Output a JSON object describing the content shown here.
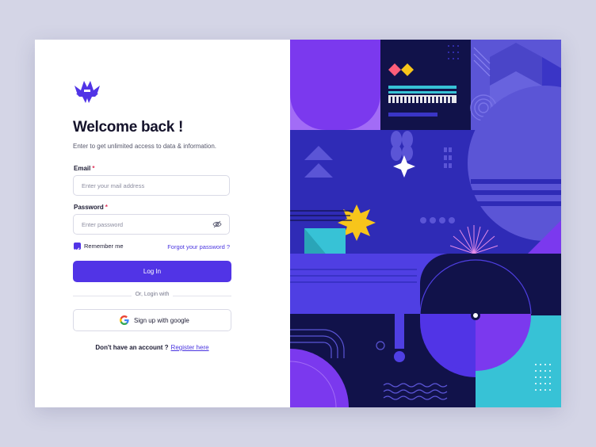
{
  "brand": {
    "logo_icon": "crown-star-logo-icon",
    "accent_color": "#5134e6"
  },
  "heading": {
    "title": "Welcome back !",
    "subtitle": "Enter to get unlimited access to data & information."
  },
  "form": {
    "email": {
      "label": "Email",
      "required_mark": "*",
      "placeholder": "Enter your mail address",
      "value": ""
    },
    "password": {
      "label": "Password",
      "required_mark": "*",
      "placeholder": "Enter password",
      "value": "",
      "toggle_icon": "eye-off-icon"
    },
    "remember_label": "Remember me",
    "remember_checked": true,
    "forgot_label": "Forgot your password ?",
    "submit_label": "Log In",
    "divider_text": "Or, Login with",
    "google_label": "Sign up with google",
    "google_icon": "google-icon"
  },
  "footer": {
    "prompt": "Don't have an account ?",
    "register_label": "Register here"
  },
  "colors": {
    "page_bg": "#d4d5e6",
    "art_dark": "#11124a",
    "art_blue": "#3a35c6",
    "art_purple": "#7b39ee",
    "art_cyan": "#37c2d6",
    "art_yellow": "#f7c51b"
  }
}
